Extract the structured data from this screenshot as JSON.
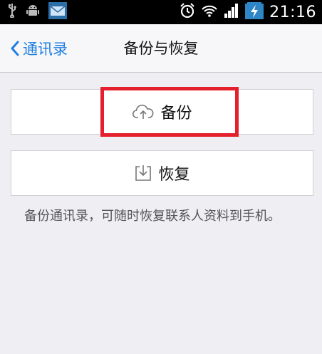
{
  "status_bar": {
    "time": "21:16",
    "icons": [
      "usb-icon",
      "android-debug-icon",
      "email-icon",
      "alarm-icon",
      "wifi-icon",
      "signal-icon",
      "battery-charging-icon"
    ]
  },
  "nav": {
    "back_label": "通讯录",
    "title": "备份与恢复"
  },
  "actions": {
    "backup_label": "备份",
    "restore_label": "恢复"
  },
  "description": "备份通讯录，可随时恢复联系人资料到手机。",
  "colors": {
    "accent": "#1f7fe0",
    "highlight": "#e4202c"
  }
}
